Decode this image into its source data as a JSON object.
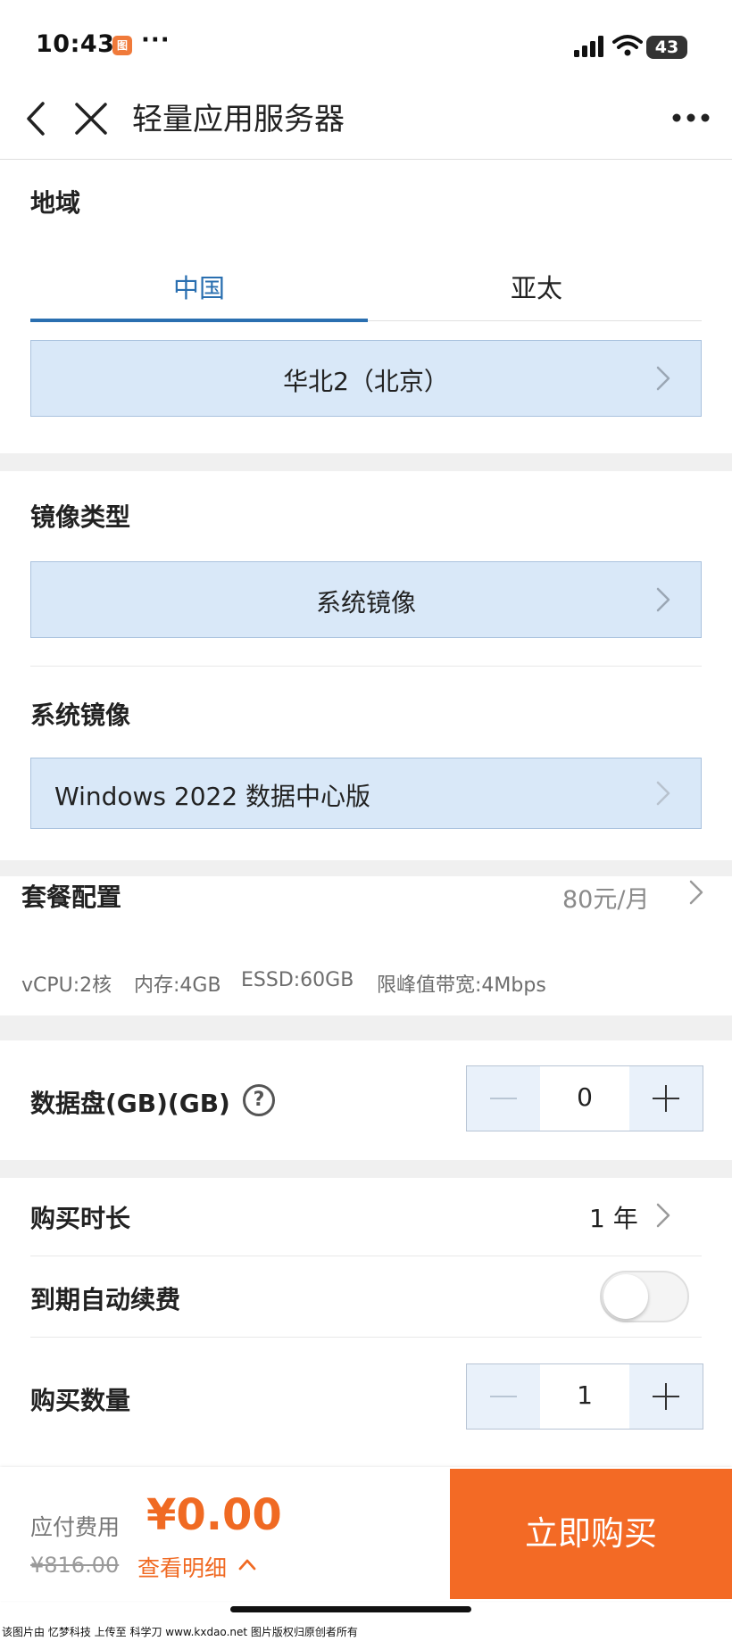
{
  "status_bar": {
    "time": "10:43",
    "app_badge": "图",
    "more_dots": "···",
    "battery": "43"
  },
  "nav": {
    "title": "轻量应用服务器"
  },
  "region": {
    "title": "地域",
    "tabs": [
      {
        "label": "中国",
        "active": true
      },
      {
        "label": "亚太",
        "active": false
      }
    ],
    "selected": "华北2（北京）"
  },
  "image_type": {
    "title": "镜像类型",
    "selected": "系统镜像"
  },
  "system_image": {
    "title": "系统镜像",
    "selected": "Windows 2022 数据中心版"
  },
  "package": {
    "title": "套餐配置",
    "price": "80元/月",
    "specs": [
      "vCPU:2核",
      "内存:4GB",
      "ESSD:60GB",
      "限峰值带宽:4Mbps"
    ]
  },
  "data_disk": {
    "label": "数据盘(GB)(GB)",
    "help": "?",
    "value": "0"
  },
  "duration": {
    "label": "购买时长",
    "value": "1 年"
  },
  "auto_renew": {
    "label": "到期自动续费",
    "enabled": false
  },
  "quantity": {
    "label": "购买数量",
    "value": "1"
  },
  "footer": {
    "fee_label": "应付费用",
    "fee_amount": "¥0.00",
    "original_price": "¥816.00",
    "detail_link": "查看明细",
    "buy_button": "立即购买"
  },
  "watermark": "该图片由 忆梦科技 上传至 科学刀 www.kxdao.net 图片版权归原创者所有",
  "colors": {
    "accent_blue": "#2a6fb0",
    "select_bg": "#d9e8f8",
    "orange": "#f36a25"
  }
}
